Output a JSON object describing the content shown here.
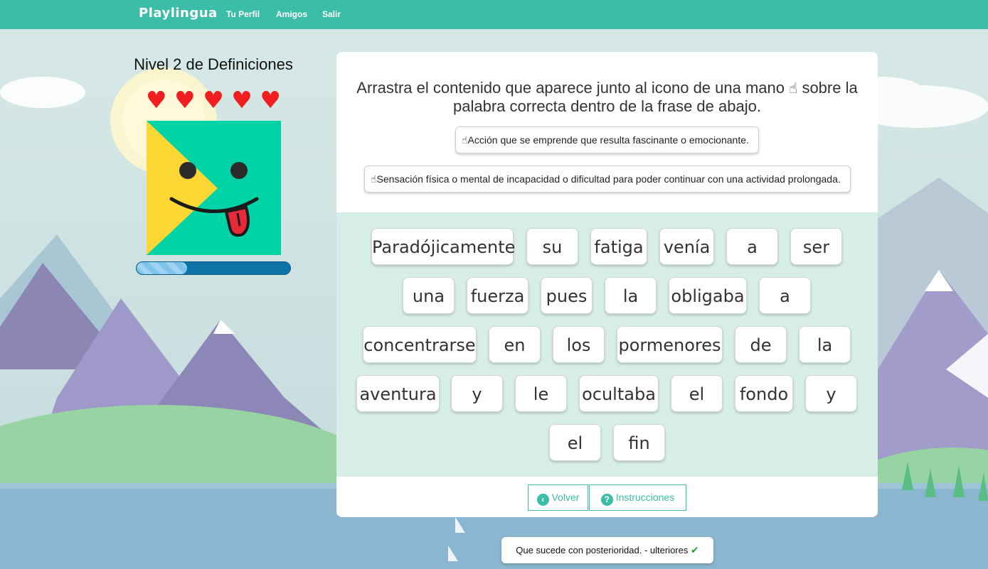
{
  "nav": {
    "brand": "Playlingua",
    "links": [
      "Tu Perfil",
      "Amigos",
      "Salir"
    ]
  },
  "game": {
    "level_title": "Nivel 2 de Definiciones",
    "lives": 5,
    "progress_fraction": 0.33
  },
  "card": {
    "instruction_before": "Arrastra el contenido que aparece junto al icono de una mano",
    "instruction_after": "sobre la palabra correcta dentro de la frase de abajo.",
    "clues": [
      "Acción que se emprende que resulta fascinante o emocionante.",
      "Sensación física o mental de incapacidad o dificultad para poder continuar con una actividad prolongada."
    ],
    "words": [
      [
        "Paradójicamente",
        "su",
        "fatiga",
        "venía",
        "a",
        "ser"
      ],
      [
        "una",
        "fuerza",
        "pues",
        "la",
        "obligaba",
        "a"
      ],
      [
        "concentrarse",
        "en",
        "los",
        "pormenores",
        "de",
        "la"
      ],
      [
        "aventura",
        "y",
        "le",
        "ocultaba",
        "el",
        "fondo",
        "y"
      ],
      [
        "el",
        "fin"
      ]
    ],
    "buttons": {
      "back": "Volver",
      "instructions": "Instrucciones"
    }
  },
  "toast": {
    "text": "Que sucede con posterioridad. - ulteriores"
  },
  "icons": {
    "hand": "pointing-hand-icon",
    "heart": "heart-icon",
    "back": "arrow-left-circle-icon",
    "help": "question-circle-icon",
    "check": "check-icon"
  },
  "colors": {
    "brand": "#3bbda7",
    "heart": "#f01e1e",
    "progress": "#0f73a7"
  }
}
